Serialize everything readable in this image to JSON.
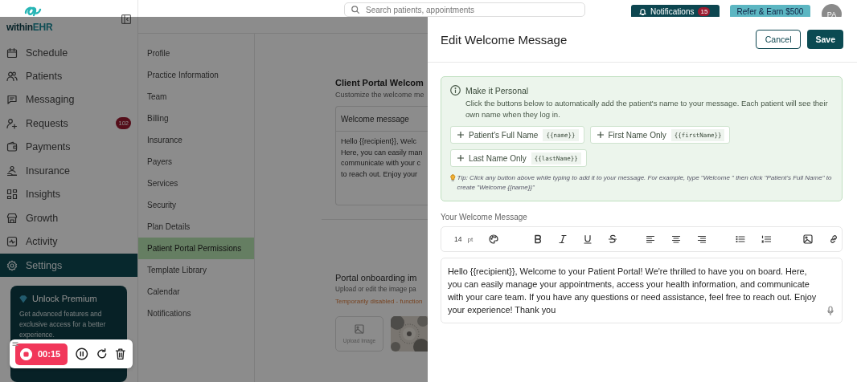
{
  "logo": {
    "part_1": "within",
    "part_2": "EHR"
  },
  "search": {
    "placeholder": "Search patients, appointments"
  },
  "notifications": {
    "label": "Notifications",
    "count": "15"
  },
  "refer_button": {
    "label": "Refer & Earn $500"
  },
  "avatar": {
    "initials": "PA"
  },
  "sidebar": {
    "items": [
      {
        "label": "Schedule",
        "selected": false
      },
      {
        "label": "Patients",
        "selected": false
      },
      {
        "label": "Messaging",
        "selected": false
      },
      {
        "label": "Requests",
        "selected": false,
        "badge": "102"
      },
      {
        "label": "Payments",
        "selected": false
      },
      {
        "label": "Insurance",
        "selected": false
      },
      {
        "label": "Insights",
        "selected": false
      },
      {
        "label": "Growth",
        "selected": false
      },
      {
        "label": "Activity",
        "selected": false
      },
      {
        "label": "Settings",
        "selected": true
      }
    ]
  },
  "premium": {
    "title": "Unlock Premium",
    "text": "Get advanced features and exclusive access for a better experience."
  },
  "settings_menu": {
    "items": [
      {
        "label": "Profile",
        "selected": false
      },
      {
        "label": "Practice Information",
        "selected": false
      },
      {
        "label": "Team",
        "selected": false
      },
      {
        "label": "Billing",
        "selected": false
      },
      {
        "label": "Insurance",
        "selected": false
      },
      {
        "label": "Payers",
        "selected": false
      },
      {
        "label": "Services",
        "selected": false
      },
      {
        "label": "Security",
        "selected": false
      },
      {
        "label": "Plan Details",
        "selected": false
      },
      {
        "label": "Patient Portal Permissions",
        "selected": true
      },
      {
        "label": "Template Library",
        "selected": false
      },
      {
        "label": "Calendar",
        "selected": false
      },
      {
        "label": "Notifications",
        "selected": false
      }
    ]
  },
  "main": {
    "title": "Client Portal Welcom",
    "subtitle": "Customize the welcome me",
    "card": {
      "header": "Welcome message",
      "lines": [
        "Hello {{recipient}}, Welc",
        "Here, you can easily man",
        "communicate with your c",
        "to reach out. Enjoy your"
      ]
    },
    "onboarding": {
      "title": "Portal onboarding im",
      "subtitle": "Upload or edit the image pa",
      "warning": "Temporarily disabled - function",
      "upload_label": "Upload Image"
    }
  },
  "drawer": {
    "title": "Edit Welcome Message",
    "cancel": "Cancel",
    "save": "Save",
    "info": {
      "title": "Make it Personal",
      "text": "Click the buttons below to automatically add the patient's name to your message. Each patient will see their own name when they log in.",
      "chips": [
        {
          "label": "Patient's Full Name",
          "token": "{{name}}"
        },
        {
          "label": "First Name Only",
          "token": "{{firstName}}"
        },
        {
          "label": "Last Name Only",
          "token": "{{lastName}}"
        }
      ],
      "tip": "Tip: Click any button above while typing to add it to your message. For example, type \"Welcome \" then click \"Patient's Full Name\" to create \"Welcome {{name}}\""
    },
    "editor": {
      "label": "Your Welcome Message",
      "font_size": "14",
      "unit": "pt",
      "text": "Hello {{recipient}}, Welcome to your Patient Portal! We're thrilled to have you on board. Here, you can easily manage your appointments, access your health information, and communicate with your care team. If you have any questions or need assistance, feel free to reach out. Enjoy your experience! Thank you"
    }
  },
  "recorder": {
    "time": "00:15"
  }
}
